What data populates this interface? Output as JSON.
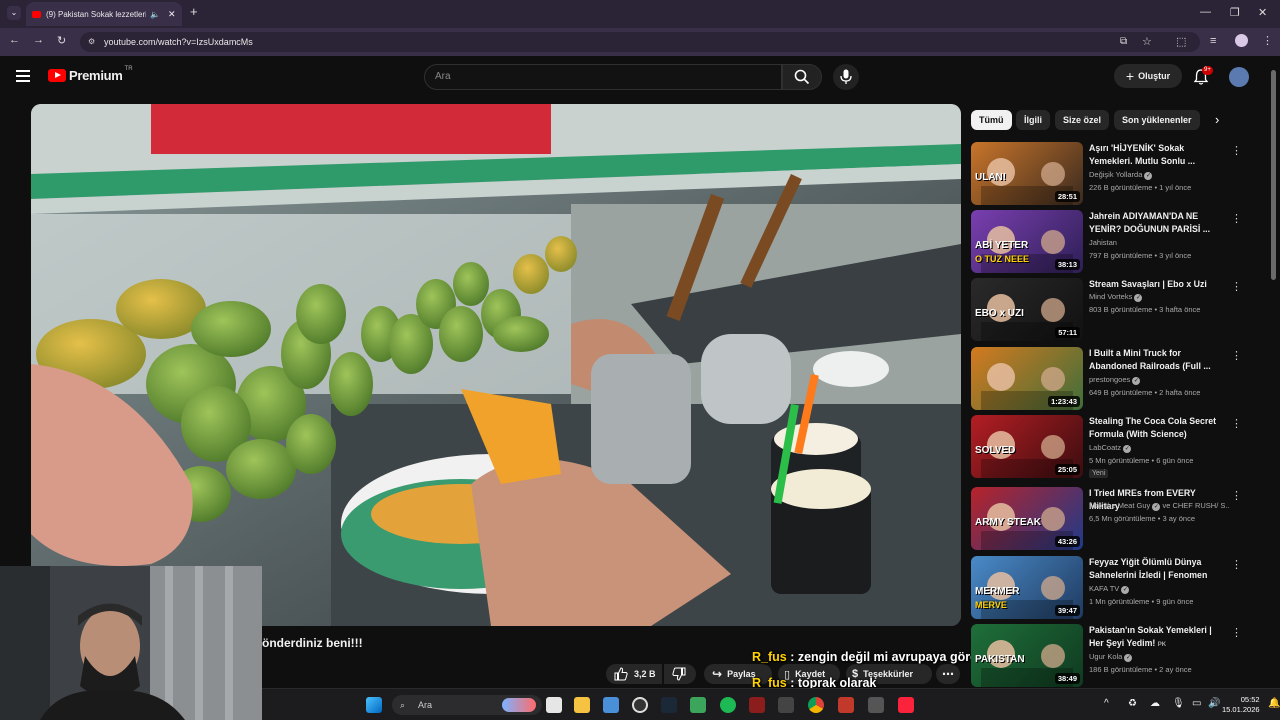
{
  "browser": {
    "tab_title": "(9) Pakistan Sokak lezzetleri",
    "url": "youtube.com/watch?v=IzsUxdamcMs"
  },
  "header": {
    "logo_text": "Premium",
    "region": "TR",
    "search_placeholder": "Ara",
    "create_label": "Oluştur",
    "notif_count": "9+"
  },
  "video": {
    "caption": "önderdiniz beni!!!",
    "like_count": "3,2 B",
    "share_label": "Paylaş",
    "save_label": "Kaydet",
    "thanks_label": "Teşekkürler"
  },
  "chat": [
    {
      "user": "R_fus",
      "sep": " : ",
      "message": "zengin değil mi avrupaya göre"
    },
    {
      "user": "R_fus",
      "sep": " : ",
      "message": "toprak olarak"
    }
  ],
  "chips": [
    "Tümü",
    "İlgili",
    "Size özel",
    "Son yüklenenler"
  ],
  "recommendations": [
    {
      "title": "Aşırı 'HİJYENİK' Sokak Yemekleri. Mutlu Sonlu ...",
      "channel": "Değişik Yollarda",
      "verified": true,
      "meta": "226 B görüntüleme • 1 yıl önce",
      "duration": "28:51",
      "thumb_text": "ULAN!",
      "colors": [
        "#c9752a",
        "#3a2a1f"
      ]
    },
    {
      "title": "Jahrein ADIYAMAN'DA NE YENİR? DOĞUNUN PARİSİ ...",
      "channel": "Jahistan",
      "verified": false,
      "meta": "797 B görüntüleme • 3 yıl önce",
      "duration": "38:13",
      "thumb_text": "ABİ YETER",
      "thumb_text2": "O TUZ NEEE",
      "colors": [
        "#7a3fb0",
        "#2d1f55"
      ]
    },
    {
      "title": "Stream Savaşları | Ebo x Uzi",
      "channel": "Mind Vorteks",
      "verified": true,
      "meta": "803 B görüntüleme • 3 hafta önce",
      "duration": "57:11",
      "thumb_text": "EBO x UZI",
      "colors": [
        "#2a2a2a",
        "#111111"
      ]
    },
    {
      "title": "I Built a Mini Truck for Abandoned Railroads (Full ...",
      "channel": "prestongoes",
      "verified": true,
      "meta": "649 B görüntüleme • 2 hafta önce",
      "duration": "1:23:43",
      "thumb_text": "",
      "colors": [
        "#d47a1f",
        "#3f6e3a"
      ]
    },
    {
      "title": "Stealing The Coca Cola Secret Formula (With Science)",
      "channel": "LabCoatz",
      "verified": true,
      "meta": "5 Mn görüntüleme • 6 gün önce",
      "duration": "25:05",
      "thumb_text": "SOLVED",
      "badge": "Yeni",
      "colors": [
        "#b41e24",
        "#3a0d0f"
      ]
    },
    {
      "title": "I Tried MREs from EVERY Military",
      "channel": "Max the Meat Guy",
      "verified": true,
      "channel_extra": "ve CHEF RUSH/ S...",
      "meta": "6,5 Mn görüntüleme • 3 ay önce",
      "duration": "43:26",
      "thumb_text": "ARMY STEAK",
      "colors": [
        "#b8232a",
        "#1e3a8a"
      ]
    },
    {
      "title": "Feyyaz Yiğit Ölümlü Dünya Sahnelerini İzledi | Fenomen ...",
      "channel": "KAFA TV",
      "verified": true,
      "meta": "1 Mn görüntüleme • 9 gün önce",
      "duration": "39:47",
      "thumb_text": "MERMER",
      "thumb_text2": "MERVE",
      "colors": [
        "#4a8bc9",
        "#1f3a5f"
      ]
    },
    {
      "title": "Pakistan'ın Sokak Yemekleri | Her Şeyi Yedim!",
      "channel": "Ugur Kola",
      "verified": true,
      "title_suffix": "PK",
      "meta": "186 B görüntüleme • 2 ay önce",
      "duration": "38:49",
      "thumb_text": "PAKISTAN",
      "colors": [
        "#1f6f3a",
        "#0f3a20"
      ]
    }
  ],
  "taskbar": {
    "search_placeholder": "Ara",
    "time": "05:52",
    "date": "15.01.2026"
  }
}
